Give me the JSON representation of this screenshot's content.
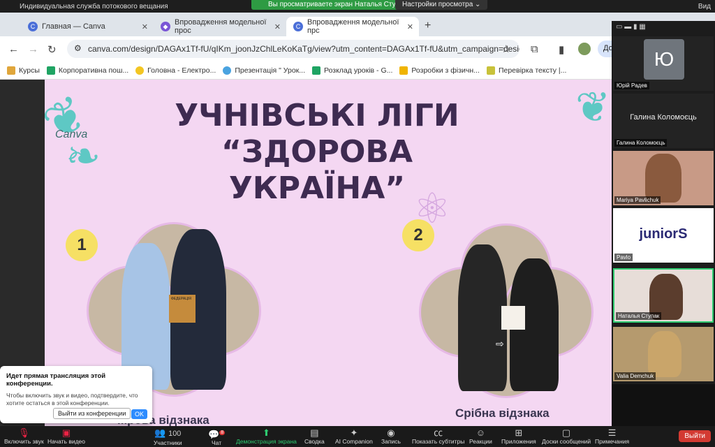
{
  "zoom_top": {
    "live_label": "Индивидуальная служба потокового вещания",
    "viewing_banner": "Вы просматриваете экран Наталья Ступак",
    "view_options": "Настройки просмотра",
    "right_label": "Вид"
  },
  "browser": {
    "tabs": [
      {
        "title": "Главная — Canva"
      },
      {
        "title": "Впровадження модельної прос"
      },
      {
        "title": "Впровадження модельної прс"
      }
    ],
    "url": "canva.com/design/DAGAx1Tf-fU/qIKm_joonJzChlLeKoKaTg/view?utm_content=DAGAx1Tf-fU&utm_campaign=design...",
    "profile_btn": "До",
    "bookmarks": [
      "Курсы",
      "Корпоративна пош...",
      "Головна - Електро...",
      "Презентація \" Урок...",
      "Розклад уроків - G...",
      "Розробки з фізичн...",
      "Перевірка тексту |..."
    ]
  },
  "slide": {
    "title_line1": "УЧНІВСЬКІ ЛІГИ",
    "title_line2": "“ЗДОРОВА",
    "title_line3": "УКРАЇНА”",
    "badge1": "1",
    "badge2": "2",
    "caption1": "...рова відзнака",
    "caption2": "Срібна відзнака",
    "certificate_text": "ФЕДЕРАЦІЯ"
  },
  "participants": [
    {
      "name": "Юрій Радев",
      "initial": "Ю"
    },
    {
      "name": "Галина Коломоєць",
      "display": "Галина Коломоєць"
    },
    {
      "name": "Mariya Pavlichuk"
    },
    {
      "name": "Pavlo",
      "logo": "juniorS"
    },
    {
      "name": "Наталья Ступак"
    },
    {
      "name": "Valia Demchuk"
    }
  ],
  "popup": {
    "heading": "Идет прямая трансляция этой конференции.",
    "body": "Чтобы включить звук и видео, подтвердите, что хотите остаться в этой конференции.",
    "exit_btn": "Выйти из конференции",
    "ok_btn": "OK"
  },
  "toolbar": {
    "audio": "Включить звук",
    "video": "Начать видео",
    "participants": "Участники",
    "participants_count": "100",
    "chat": "Чат",
    "chat_badge": "8",
    "share": "Демонстрация экрана",
    "summary": "Сводка",
    "ai": "AI Companion",
    "record": "Запись",
    "captions": "Показать субтитры",
    "reactions": "Реакции",
    "apps": "Приложения",
    "whiteboards": "Доски сообщений",
    "notes": "Примечания",
    "leave": "Выйти"
  },
  "colors": {
    "slide_bg": "#f4d7f2",
    "title": "#3e2b51",
    "badge": "#f6e064",
    "zoom_green": "#2e9b43",
    "leave_red": "#d33a32"
  }
}
